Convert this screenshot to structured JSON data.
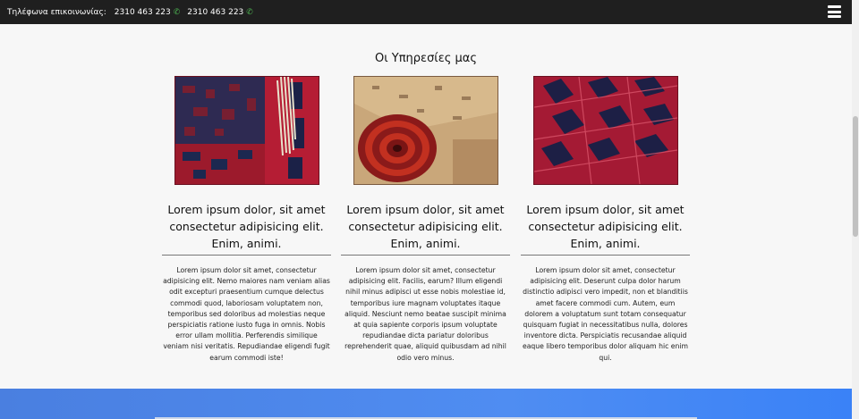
{
  "topbar": {
    "label": "Τηλέφωνα επικοινωνίας:",
    "phones": [
      "2310 463 223",
      "2310 463 223"
    ],
    "phone_icon": "phone-icon",
    "menu_icon": "hamburger-menu-icon"
  },
  "services": {
    "title": "Οι Υπηρεσίες μας",
    "cards": [
      {
        "image": "rug-corner-fringe-image",
        "heading": "Lorem ipsum dolor, sit amet consectetur adipisicing elit. Enim, animi.",
        "text": "Lorem ipsum dolor sit amet, consectetur adipisicing elit. Nemo maiores nam veniam alias odit excepturi praesentium cumque delectus commodi quod, laboriosam voluptatem non, temporibus sed doloribus ad molestias neque perspiciatis ratione iusto fuga in omnis. Nobis error ullam mollitia. Perferendis similique veniam nisi veritatis. Repudiandae eligendi fugit earum commodi iste!"
      },
      {
        "image": "rolled-rug-image",
        "heading": "Lorem ipsum dolor, sit amet consectetur adipisicing elit. Enim, animi.",
        "text": "Lorem ipsum dolor sit amet, consectetur adipisicing elit. Facilis, earum? Illum eligendi nihil minus adipisci ut esse nobis molestiae id, temporibus iure magnam voluptates itaque aliquid. Nesciunt nemo beatae suscipit minima at quia sapiente corporis ipsum voluptate repudiandae dicta pariatur doloribus reprehenderit quae, aliquid quibusdam ad nihil odio vero minus."
      },
      {
        "image": "red-pattern-rug-image",
        "heading": "Lorem ipsum dolor, sit amet consectetur adipisicing elit. Enim, animi.",
        "text": "Lorem ipsum dolor sit amet, consectetur adipisicing elit. Deserunt culpa dolor harum distinctio adipisci vero impedit, non et blanditiis amet facere commodi cum. Autem, eum dolorem a voluptatum sunt totam consequatur quisquam fugiat in necessitatibus nulla, dolores inventore dicta. Perspiciatis recusandae aliquid eaque libero temporibus dolor aliquam hic enim qui."
      }
    ]
  },
  "colors": {
    "topbar_bg": "#1f1f1f",
    "phone_icon": "#4caf50",
    "footer_blue": "#4f8df2"
  }
}
